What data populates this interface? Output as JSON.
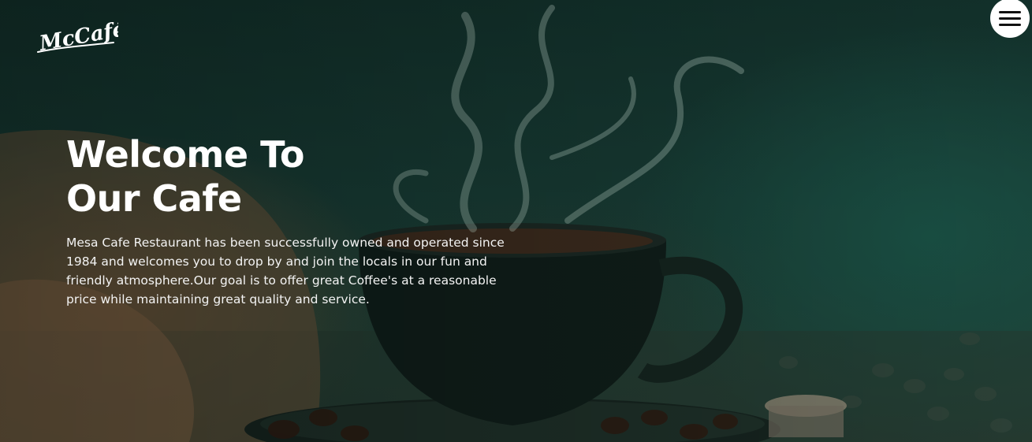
{
  "header": {
    "logo_text": "McCafé",
    "menu_icon": "hamburger-menu-icon"
  },
  "hero": {
    "title_line1": "Welcome To",
    "title_line2": "Our Cafe",
    "description": "Mesa Cafe Restaurant has been successfully owned and operated since 1984 and welcomes you to drop by and join the locals in our fun and friendly atmosphere.Our goal is to offer great Coffee's at a reasonable price while maintaining great quality and service.",
    "background_image": "coffee-cup-steam-beans-image"
  },
  "colors": {
    "background": "#173a33",
    "text": "#ffffff",
    "menu_button": "#ffffff"
  }
}
